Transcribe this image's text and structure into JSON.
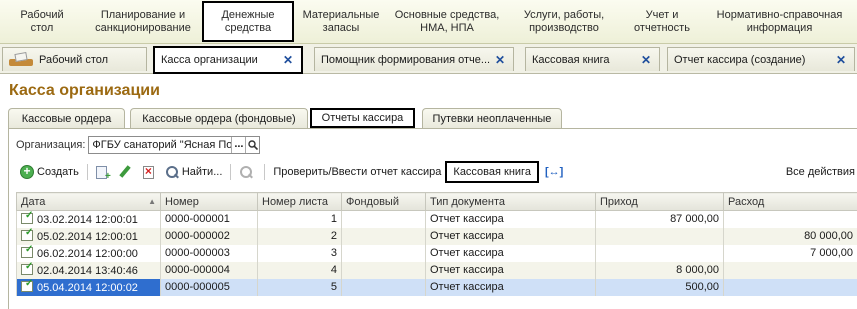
{
  "sections": [
    {
      "label": "Рабочий\nстол"
    },
    {
      "label": "Планирование и\nсанкционирование"
    },
    {
      "label": "Денежные\nсредства"
    },
    {
      "label": "Материальные\nзапасы"
    },
    {
      "label": "Основные средства,\nНМА, НПА"
    },
    {
      "label": "Услуги, работы,\nпроизводство"
    },
    {
      "label": "Учет и\nотчетность"
    },
    {
      "label": "Нормативно-справочная\nинформация"
    }
  ],
  "window_tabs": [
    {
      "label": "Рабочий стол"
    },
    {
      "label": "Касса организации"
    },
    {
      "label": "Помощник формирования отче..."
    },
    {
      "label": "Кассовая книга"
    },
    {
      "label": "Отчет кассира (создание)"
    }
  ],
  "page_title": "Касса организации",
  "inner_tabs": [
    {
      "label": "Кассовые ордера"
    },
    {
      "label": "Кассовые ордера (фондовые)"
    },
    {
      "label": "Отчеты кассира"
    },
    {
      "label": "Путевки неоплаченные"
    }
  ],
  "organization": {
    "label": "Организация:",
    "value": "ФГБУ санаторий \"Ясная Поляна\"",
    "dots": "..."
  },
  "toolbar": {
    "create": "Создать",
    "find": "Найти...",
    "report": "Проверить/Ввести отчет кассира",
    "cash_book": "Кассовая книга",
    "all_actions": "Все действия",
    "link_symbol": "[↔]"
  },
  "table": {
    "columns": [
      "Дата",
      "Номер",
      "Номер листа",
      "Фондовый",
      "Тип документа",
      "Приход",
      "Расход"
    ],
    "rows": [
      {
        "date": "03.02.2014 12:00:01",
        "number": "0000-000001",
        "sheet": "1",
        "fund": "",
        "type": "Отчет кассира",
        "income": "87 000,00",
        "expense": ""
      },
      {
        "date": "05.02.2014 12:00:01",
        "number": "0000-000002",
        "sheet": "2",
        "fund": "",
        "type": "Отчет кассира",
        "income": "",
        "expense": "80 000,00"
      },
      {
        "date": "06.02.2014 12:00:00",
        "number": "0000-000003",
        "sheet": "3",
        "fund": "",
        "type": "Отчет кассира",
        "income": "",
        "expense": "7 000,00"
      },
      {
        "date": "02.04.2014 13:40:46",
        "number": "0000-000004",
        "sheet": "4",
        "fund": "",
        "type": "Отчет кассира",
        "income": "8 000,00",
        "expense": ""
      },
      {
        "date": "05.04.2014 12:00:02",
        "number": "0000-000005",
        "sheet": "5",
        "fund": "",
        "type": "Отчет кассира",
        "income": "500,00",
        "expense": ""
      }
    ]
  },
  "colors": {
    "title": "#9c6a12",
    "selected_row": "#cfe0f7",
    "selected_cell": "#2f6ecf"
  }
}
